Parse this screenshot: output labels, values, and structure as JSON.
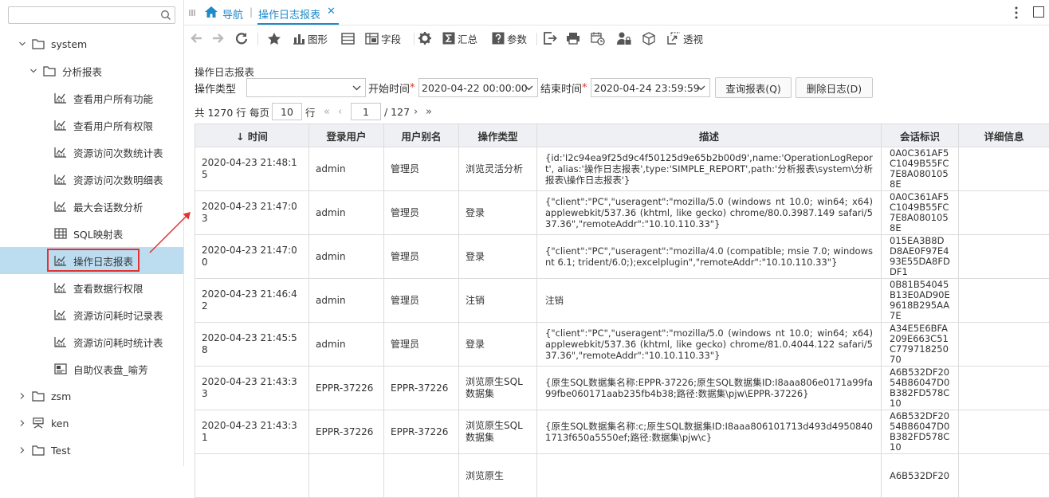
{
  "sidebar": {
    "search_placeholder": "",
    "tree": [
      {
        "label": "system",
        "icon": "folder-icon",
        "expanded": true
      },
      {
        "label": "分析报表",
        "icon": "folder-icon",
        "expanded": true
      },
      {
        "label": "查看用户所有功能",
        "icon": "line-chart-icon"
      },
      {
        "label": "查看用户所有权限",
        "icon": "line-chart-icon"
      },
      {
        "label": "资源访问次数统计表",
        "icon": "line-chart-icon"
      },
      {
        "label": "资源访问次数明细表",
        "icon": "line-chart-icon"
      },
      {
        "label": "最大会话数分析",
        "icon": "line-chart-icon"
      },
      {
        "label": "SQL映射表",
        "icon": "grid-table-icon"
      },
      {
        "label": "操作日志报表",
        "icon": "line-chart-icon",
        "selected": true
      },
      {
        "label": "查看数据行权限",
        "icon": "line-chart-icon"
      },
      {
        "label": "资源访问耗时记录表",
        "icon": "line-chart-icon"
      },
      {
        "label": "资源访问耗时统计表",
        "icon": "line-chart-icon"
      },
      {
        "label": "自助仪表盘_喻芳",
        "icon": "dashboard-icon"
      },
      {
        "label": "zsm",
        "icon": "folder-icon",
        "expanded": false
      },
      {
        "label": "ken",
        "icon": "user-icon",
        "expanded": false
      },
      {
        "label": "Test",
        "icon": "folder-icon",
        "expanded": false
      }
    ]
  },
  "tabs": {
    "home_label": "导航",
    "active_label": "操作日志报表"
  },
  "toolbar": {
    "chart_label": "图形",
    "field_label": "字段",
    "sum_label": "汇总",
    "param_label": "参数",
    "pivot_label": "透视"
  },
  "report": {
    "title": "操作日志报表",
    "op_type_label": "操作类型",
    "op_type_value": "",
    "start_label": "开始时间",
    "start_value": "2020-04-22 00:00:00",
    "end_label": "结束时间",
    "end_value": "2020-04-24 23:59:59",
    "required_mark": "*",
    "query_button": "查询报表(Q)",
    "delete_button": "删除日志(D)"
  },
  "pager": {
    "total": "共 1270 行",
    "per_page_label": "每页",
    "per_page_value": "10",
    "rows_unit": "行",
    "page_value": "1",
    "total_pages": "/ 127"
  },
  "table": {
    "headers": [
      "时间",
      "登录用户",
      "用户别名",
      "操作类型",
      "描述",
      "会话标识",
      "详细信息"
    ],
    "sort_arrow": "↓",
    "rows": [
      [
        "2020-04-23  21:48:15",
        "admin",
        "管理员",
        "浏览灵活分析",
        "{id:'I2c94ea9f25d9c4f50125d9e65b2b00d9',name:'OperationLogReport', alias:'操作日志报表',type:'SIMPLE_REPORT',path:'分析报表\\system\\分析报表\\操作日志报表'}",
        "0A0C361AF5C1049B55FC7E8A0801058E",
        ""
      ],
      [
        "2020-04-23  21:47:03",
        "admin",
        "管理员",
        "登录",
        "{\"client\":\"PC\",\"useragent\":\"mozilla/5.0 (windows nt 10.0; win64; x64) applewebkit/537.36 (khtml, like gecko) chrome/80.0.3987.149 safari/537.36\",\"remoteAddr\":\"10.10.110.33\"}",
        "0A0C361AF5C1049B55FC7E8A0801058E",
        ""
      ],
      [
        "2020-04-23  21:47:00",
        "admin",
        "管理员",
        "登录",
        "{\"client\":\"PC\",\"useragent\":\"mozilla/4.0 (compatible; msie 7.0; windows nt 6.1; trident/6.0;);excelplugin\",\"remoteAddr\":\"10.10.110.33\"}",
        "015EA3B8DD8AE0F97E493E55DA8FDDF1",
        ""
      ],
      [
        "2020-04-23  21:46:42",
        "admin",
        "管理员",
        "注销",
        "注销",
        "0B81B54045B13E0AD90E9618B295AA7E",
        ""
      ],
      [
        "2020-04-23  21:45:58",
        "admin",
        "管理员",
        "登录",
        "{\"client\":\"PC\",\"useragent\":\"mozilla/5.0 (windows nt 10.0; win64; x64) applewebkit/537.36 (khtml, like gecko) chrome/81.0.4044.122 safari/537.36\",\"remoteAddr\":\"10.10.110.33\"}",
        "A34E5E6BFA209E663C51C77971825070",
        ""
      ],
      [
        "2020-04-23  21:43:33",
        "EPPR-37226",
        "EPPR-37226",
        "浏览原生SQL数据集",
        "{原生SQL数据集名称:EPPR-37226;原生SQL数据集ID:I8aaa806e0171a99fa99fbe060171aab235fb4b38;路径:数据集\\pjw\\EPPR-37226}",
        "A6B532DF2054B86047D0B382FD578C10",
        ""
      ],
      [
        "2020-04-23  21:43:31",
        "EPPR-37226",
        "EPPR-37226",
        "浏览原生SQL数据集",
        "{原生SQL数据集名称:c;原生SQL数据集ID:I8aaa806101713d493d49508401713f650a5550ef;路径:数据集\\pjw\\c}",
        "A6B532DF2054B86047D0B382FD578C10",
        ""
      ],
      [
        "",
        "",
        "",
        "浏览原生",
        "",
        "A6B532DF20",
        ""
      ]
    ]
  },
  "colors": {
    "accent": "#1f8acb",
    "selected_bg": "#bcdcf0",
    "highlight_border": "#e23232",
    "header_bg": "#eef0f3"
  }
}
